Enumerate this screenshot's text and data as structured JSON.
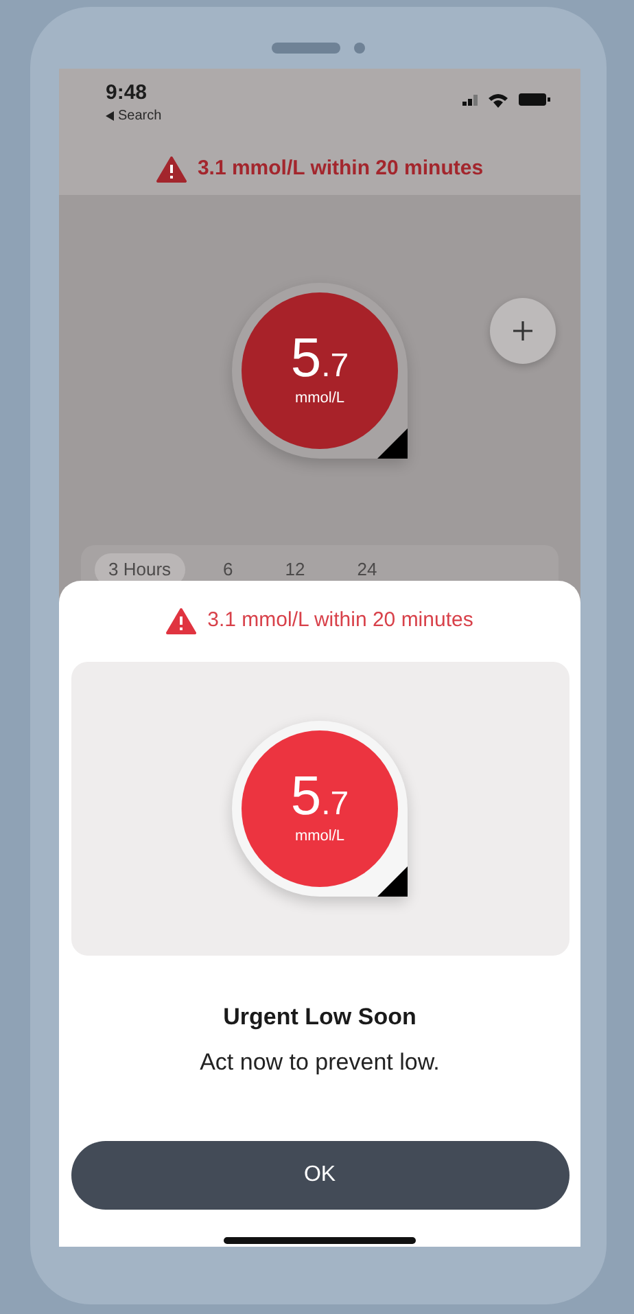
{
  "status_bar": {
    "time": "9:48",
    "back_label": "Search"
  },
  "background_screen": {
    "alert": "3.1 mmol/L within 20 minutes",
    "reading": {
      "value": "5$_{.7}$",
      "unit": "mmol/L"
    },
    "time_ranges": [
      {
        "label": "3 Hours",
        "selected": true
      },
      {
        "label": "6",
        "selected": false
      },
      {
        "label": "12",
        "selected": false
      },
      {
        "label": "24",
        "selected": false
      }
    ]
  },
  "alert_sheet": {
    "alert": "3.1 mmol/L within 20 minutes",
    "reading": {
      "value": "5$_{.7}$",
      "unit": "mmol/L"
    },
    "title": "Urgent Low Soon",
    "message": "Act now to prevent low.",
    "button": "OK"
  }
}
